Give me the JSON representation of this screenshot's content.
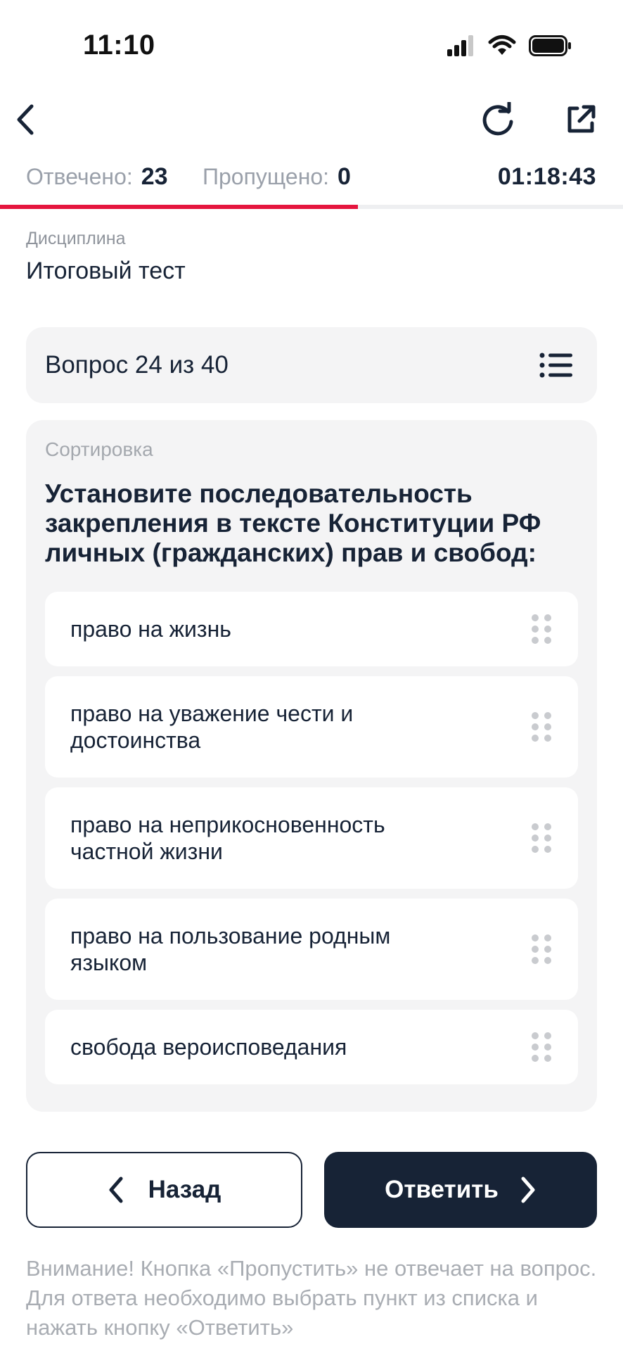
{
  "status_bar": {
    "time": "11:10"
  },
  "progress": {
    "answered_label": "Отвечено:",
    "answered_value": "23",
    "skipped_label": "Пропущено:",
    "skipped_value": "0",
    "timer": "01:18:43",
    "fraction": 0.575,
    "accent_color": "#e5153e"
  },
  "discipline": {
    "label": "Дисциплина",
    "value": "Итоговый тест"
  },
  "question": {
    "header": "Вопрос 24 из 40",
    "type": "Сортировка",
    "text": "Установите последовательность закрепления в тексте Конституции РФ личных (гражданских) прав и свобод:",
    "options": [
      "право на жизнь",
      "право на уважение чести и достоинства",
      "право на неприкосновенность частной жизни",
      "право на пользование родным языком",
      "свобода вероисповедания"
    ]
  },
  "buttons": {
    "back_label": "Назад",
    "answer_label": "Ответить",
    "primary_color": "#172336"
  },
  "notice": "Внимание! Кнопка «Пропустить» не отвечает на вопрос. Для ответа необходимо выбрать пункт из списка и нажать кнопку «Ответить»",
  "icons": [
    "back-icon",
    "refresh-icon",
    "share-icon",
    "list-icon",
    "drag-handle-icon",
    "chevron-left-icon",
    "chevron-right-icon",
    "signal-icon",
    "wifi-icon",
    "battery-icon"
  ]
}
